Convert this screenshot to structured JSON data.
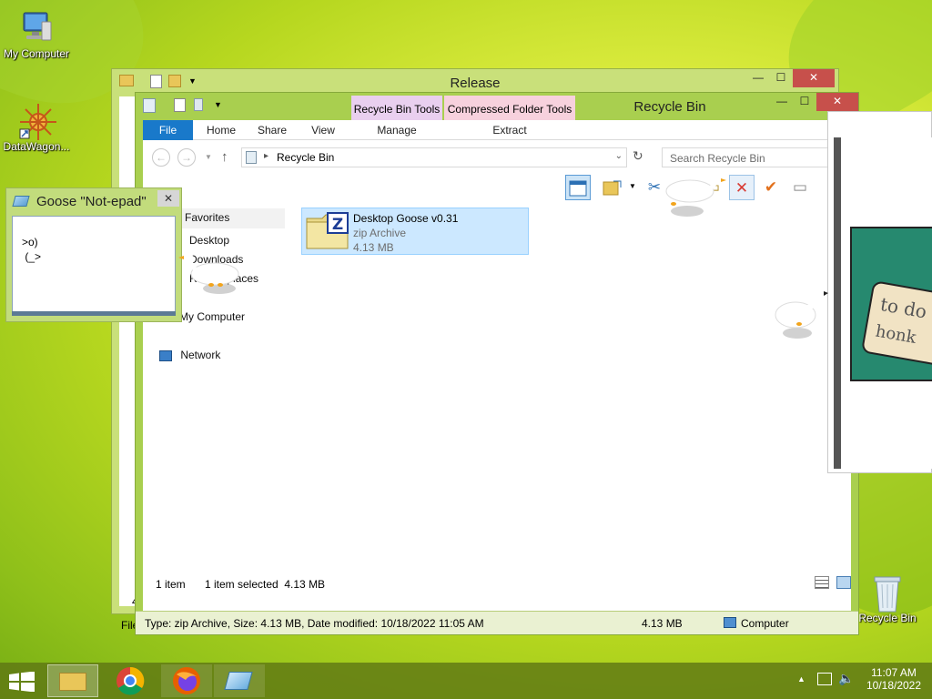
{
  "desktop": {
    "icons": [
      {
        "label": "My Computer"
      },
      {
        "label": "DataWagon..."
      },
      {
        "label": "Recycle Bin"
      }
    ]
  },
  "release_window": {
    "title": "Release",
    "status_fragment": "File",
    "left_fragment": "4"
  },
  "recycle_window": {
    "title": "Recycle Bin",
    "context_tabs": [
      {
        "label": "Recycle Bin Tools",
        "color": "#e9cfef"
      },
      {
        "label": "Compressed Folder Tools",
        "color": "#f7d1dd"
      }
    ],
    "ribbon_tabs": [
      "File",
      "Home",
      "Share",
      "View",
      "Manage",
      "Extract"
    ],
    "address": "Recycle Bin",
    "search_placeholder": "Search Recycle Bin",
    "nav": {
      "favorites": "Favorites",
      "desktop": "Desktop",
      "downloads": "Downloads",
      "recent": "Recent places",
      "computer": "My Computer",
      "network": "Network"
    },
    "file": {
      "name": "Desktop Goose v0.31",
      "type": "zip Archive",
      "size": "4.13 MB"
    },
    "status": {
      "count": "1 item",
      "selected": "1 item selected  4.13 MB"
    },
    "details": {
      "text": "Type: zip Archive, Size: 4.13 MB, Date modified: 10/18/2022 11:05 AM",
      "size": "4.13 MB",
      "location": "Computer"
    }
  },
  "notepad": {
    "title": "Goose \"Not-epad\"",
    "content": ">o)\n (_>"
  },
  "meme": {
    "line1": "to do",
    "line2": "honk"
  },
  "taskbar": {
    "time": "11:07 AM",
    "date": "10/18/2022"
  },
  "colors": {
    "accent": "#1979ca",
    "window_frame": "#a9cf4f",
    "selection": "#cce8ff",
    "close": "#c7504b"
  }
}
